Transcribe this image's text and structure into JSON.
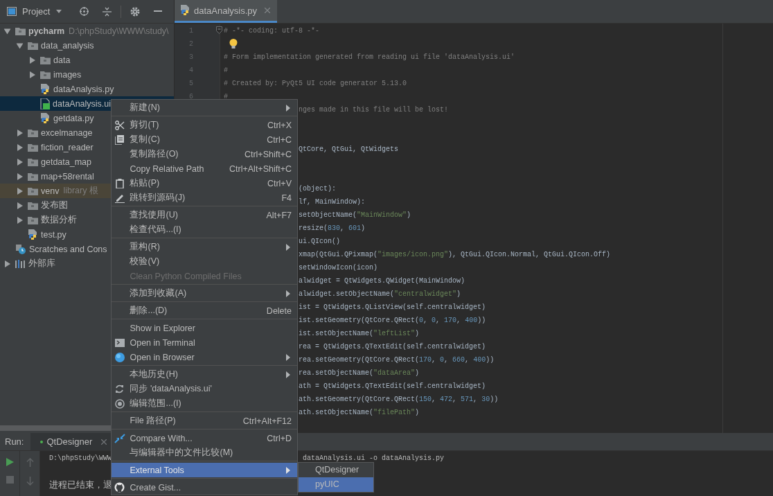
{
  "project_panel": {
    "title": "Project"
  },
  "editor_tabs": [
    {
      "label": "dataAnalysis.py",
      "kind": "python",
      "selected": true
    }
  ],
  "tree": [
    {
      "label": "pycharm",
      "kind": "project",
      "hint": "D:\\phpStudy\\WWW\\study\\",
      "expanded": true,
      "selected": false,
      "excluded": false,
      "children": [
        {
          "label": "data_analysis",
          "kind": "folder",
          "expanded": true,
          "selected": false,
          "excluded": false,
          "children": [
            {
              "label": "data",
              "kind": "folder",
              "expanded": false,
              "selected": false,
              "excluded": false
            },
            {
              "label": "images",
              "kind": "folder",
              "expanded": false,
              "selected": false,
              "excluded": false
            },
            {
              "label": "dataAnalysis.py",
              "kind": "python",
              "selected": false,
              "excluded": false
            },
            {
              "label": "dataAnalysis.ui",
              "kind": "qt",
              "selected": true,
              "excluded": false
            },
            {
              "label": "getdata.py",
              "kind": "python",
              "selected": false,
              "excluded": false
            }
          ]
        },
        {
          "label": "excelmanage",
          "kind": "folder",
          "expanded": false,
          "selected": false,
          "excluded": false
        },
        {
          "label": "fiction_reader",
          "kind": "folder",
          "expanded": false,
          "selected": false,
          "excluded": false
        },
        {
          "label": "getdata_map",
          "kind": "folder",
          "expanded": false,
          "selected": false,
          "excluded": false
        },
        {
          "label": "map+58rental",
          "kind": "folder",
          "expanded": false,
          "selected": false,
          "excluded": false
        },
        {
          "label": "venv",
          "kind": "folder",
          "hint": "library 根",
          "expanded": false,
          "selected": false,
          "excluded": true
        },
        {
          "label": "发布图",
          "kind": "folder",
          "expanded": false,
          "selected": false,
          "excluded": false
        },
        {
          "label": "数据分析",
          "kind": "folder",
          "expanded": false,
          "selected": false,
          "excluded": false
        },
        {
          "label": "test.py",
          "kind": "python",
          "selected": false,
          "excluded": false
        }
      ]
    },
    {
      "label": "Scratches and Cons",
      "kind": "scratches",
      "selected": false,
      "excluded": false
    },
    {
      "label": "外部库",
      "kind": "library",
      "expanded": false,
      "selected": false,
      "excluded": false
    }
  ],
  "editor": {
    "lines": [
      {
        "number": "1",
        "fold_marker": true,
        "kind": "comment",
        "text": "# -*- coding: utf-8 -*-"
      },
      {
        "number": "2",
        "fold_marker": false,
        "kind": "hint"
      },
      {
        "number": "3",
        "fold_marker": false,
        "kind": "comment",
        "text": "# Form implementation generated from reading ui file 'dataAnalysis.ui'"
      },
      {
        "number": "4",
        "fold_marker": false,
        "kind": "comment",
        "text": "#"
      },
      {
        "number": "5",
        "fold_marker": false,
        "kind": "comment",
        "text": "# Created by: PyQt5 UI code generator 5.13.0"
      },
      {
        "number": "6",
        "fold_marker": false,
        "kind": "comment",
        "text": "#"
      },
      {
        "kind": "covered",
        "text": "nges made in this file will be lost!",
        "comment": true
      },
      {
        "kind": "blank"
      },
      {
        "kind": "blank"
      },
      {
        "kind": "covered",
        "text": "QtCore, QtGui, QtWidgets",
        "comment": false
      },
      {
        "kind": "blank"
      },
      {
        "kind": "blank"
      },
      {
        "kind": "covered",
        "text": "(object):",
        "comment": false
      },
      {
        "kind": "covered",
        "text": "lf, MainWindow):",
        "comment": false
      },
      {
        "kind": "covered",
        "text": "setObjectName(\"MainWindow\")",
        "comment": false
      },
      {
        "kind": "covered",
        "text": "resize(830, 601)",
        "comment": false
      },
      {
        "kind": "covered",
        "text": "ui.QIcon()",
        "comment": false
      },
      {
        "kind": "covered",
        "text": "xmap(QtGui.QPixmap(\"images/icon.png\"), QtGui.QIcon.Normal, QtGui.QIcon.Off)",
        "comment": false
      },
      {
        "kind": "covered",
        "text": "setWindowIcon(icon)",
        "comment": false
      },
      {
        "kind": "covered",
        "text": "alwidget = QtWidgets.QWidget(MainWindow)",
        "comment": false
      },
      {
        "kind": "covered",
        "text": "alwidget.setObjectName(\"centralwidget\")",
        "comment": false
      },
      {
        "kind": "covered",
        "text": "ist = QtWidgets.QListView(self.centralwidget)",
        "comment": false
      },
      {
        "kind": "covered",
        "text": "ist.setGeometry(QtCore.QRect(0, 0, 170, 400))",
        "comment": false
      },
      {
        "kind": "covered",
        "text": "ist.setObjectName(\"leftList\")",
        "comment": false
      },
      {
        "kind": "covered",
        "text": "rea = QtWidgets.QTextEdit(self.centralwidget)",
        "comment": false
      },
      {
        "kind": "covered",
        "text": "rea.setGeometry(QtCore.QRect(170, 0, 660, 400))",
        "comment": false
      },
      {
        "kind": "covered",
        "text": "rea.setObjectName(\"dataArea\")",
        "comment": false
      },
      {
        "kind": "covered",
        "text": "ath = QtWidgets.QTextEdit(self.centralwidget)",
        "comment": false
      },
      {
        "kind": "covered",
        "text": "ath.setGeometry(QtCore.QRect(150, 472, 571, 30))",
        "comment": false
      },
      {
        "kind": "covered",
        "text": "ath.setObjectName(\"filePath\")",
        "comment": false
      }
    ]
  },
  "context_menu": {
    "groups": [
      {
        "items": [
          {
            "label": "新建(N)",
            "submenu": true,
            "disabled": false,
            "selected": false
          }
        ]
      },
      {
        "items": [
          {
            "label": "剪切(T)",
            "kind": "scissors",
            "shortcut": "Ctrl+X",
            "submenu": false,
            "disabled": false,
            "selected": false
          },
          {
            "label": "复制(C)",
            "kind": "copy",
            "shortcut": "Ctrl+C",
            "submenu": false,
            "disabled": false,
            "selected": false
          },
          {
            "label": "复制路径(O)",
            "shortcut": "Ctrl+Shift+C",
            "submenu": false,
            "disabled": false,
            "selected": false
          },
          {
            "label": "Copy Relative Path",
            "shortcut": "Ctrl+Alt+Shift+C",
            "submenu": false,
            "disabled": false,
            "selected": false
          },
          {
            "label": "粘贴(P)",
            "kind": "clipboard",
            "shortcut": "Ctrl+V",
            "submenu": false,
            "disabled": false,
            "selected": false
          },
          {
            "label": "跳转到源码(J)",
            "kind": "pencil",
            "shortcut": "F4",
            "submenu": false,
            "disabled": false,
            "selected": false
          }
        ]
      },
      {
        "items": [
          {
            "label": "查找使用(U)",
            "shortcut": "Alt+F7",
            "submenu": false,
            "disabled": false,
            "selected": false
          },
          {
            "label": "检查代码...(I)",
            "submenu": false,
            "disabled": false,
            "selected": false
          }
        ]
      },
      {
        "items": [
          {
            "label": "重构(R)",
            "submenu": true,
            "disabled": false,
            "selected": false
          },
          {
            "label": "校验(V)",
            "submenu": false,
            "disabled": false,
            "selected": false
          },
          {
            "label": "Clean Python Compiled Files",
            "submenu": false,
            "disabled": true,
            "selected": false
          }
        ]
      },
      {
        "items": [
          {
            "label": "添加到收藏(A)",
            "submenu": true,
            "disabled": false,
            "selected": false
          }
        ]
      },
      {
        "items": [
          {
            "label": "删除...(D)",
            "shortcut": "Delete",
            "submenu": false,
            "disabled": false,
            "selected": false
          }
        ]
      },
      {
        "items": [
          {
            "label": "Show in Explorer",
            "submenu": false,
            "disabled": false,
            "selected": false
          },
          {
            "label": "Open in Terminal",
            "kind": "terminal",
            "submenu": false,
            "disabled": false,
            "selected": false
          },
          {
            "label": "Open in Browser",
            "kind": "globe",
            "submenu": true,
            "disabled": false,
            "selected": false
          }
        ]
      },
      {
        "items": [
          {
            "label": "本地历史(H)",
            "submenu": true,
            "disabled": false,
            "selected": false
          },
          {
            "label": "同步 'dataAnalysis.ui'",
            "kind": "sync",
            "submenu": false,
            "disabled": false,
            "selected": false
          },
          {
            "label": "编辑范围...(I)",
            "kind": "scope",
            "submenu": false,
            "disabled": false,
            "selected": false
          }
        ]
      },
      {
        "items": [
          {
            "label": "File 路径(P)",
            "shortcut": "Ctrl+Alt+F12",
            "submenu": false,
            "disabled": false,
            "selected": false
          }
        ]
      },
      {
        "items": [
          {
            "label": "Compare With...",
            "kind": "compare",
            "shortcut": "Ctrl+D",
            "submenu": false,
            "disabled": false,
            "selected": false
          },
          {
            "label": "与编辑器中的文件比较(M)",
            "submenu": false,
            "disabled": false,
            "selected": false
          }
        ]
      },
      {
        "items": [
          {
            "label": "External Tools",
            "submenu": true,
            "disabled": false,
            "selected": true
          }
        ]
      },
      {
        "items": [
          {
            "label": "Create Gist...",
            "kind": "github",
            "submenu": false,
            "disabled": false,
            "selected": false
          }
        ]
      }
    ]
  },
  "submenu": {
    "items": [
      {
        "label": "QtDesigner",
        "selected": false
      },
      {
        "label": "pyUIC",
        "selected": true
      }
    ]
  },
  "run_panel": {
    "label": "Run:",
    "tabs": [
      {
        "label": "QtDesigner",
        "selected": true
      }
    ],
    "console": [
      {
        "kind": "output",
        "text": "D:\\phpStudy\\WWW",
        "covered_text": "dataAnalysis.ui -o dataAnalysis.py"
      },
      {
        "kind": "blank"
      },
      {
        "kind": "output",
        "text": "进程已结束，退"
      }
    ]
  }
}
